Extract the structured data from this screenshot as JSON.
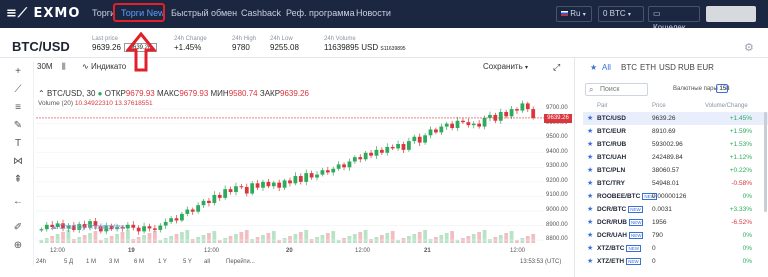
{
  "app": {
    "logo": "EXMO"
  },
  "nav": {
    "items": [
      "Торги",
      "Торги New",
      "Быстрый обмен",
      "Cashback",
      "Реф. программа",
      "Новости"
    ]
  },
  "topbar_right": {
    "language": "Ru",
    "balance": "0 BTC",
    "wallet": "Кошелек"
  },
  "ticker": {
    "pair": "BTC/USD",
    "last_price_label": "Last price",
    "last_price": "9639.26",
    "last_price_badge": "9639.26",
    "change_label": "24h Change",
    "change": "+1.45%",
    "high_label": "24h High",
    "high": "9780",
    "low_label": "24h Low",
    "low": "9255.08",
    "volume_label": "24h Volume",
    "volume": "11639895 USD",
    "volume_btc": "S11639895"
  },
  "chart_toolbar": {
    "interval": "30M",
    "indicators": "Индикато",
    "save": "Сохранить"
  },
  "legend": {
    "symbol": "BTC/USD, 30",
    "open_label": "ОТКР",
    "open": "9679.93",
    "high_label": "МАКС",
    "high": "9679.93",
    "low_label": "МИН",
    "low": "9580.74",
    "close_label": "ЗАКР",
    "close": "9639.26",
    "volume_label": "Volume (20)",
    "volume_a": "10.34922310",
    "volume_b": "13.37618551"
  },
  "chart_data": {
    "type": "candlestick",
    "series": [
      {
        "name": "BTC/USD, 30",
        "values": [
          8875,
          8905,
          8890,
          8915,
          8880,
          8900,
          8870,
          8910,
          8885,
          8930,
          8895,
          8860,
          8900,
          8875,
          8890,
          8880,
          8905,
          8885,
          8860,
          8895,
          8880,
          8870,
          8900,
          8925,
          8950,
          8935,
          8980,
          9010,
          8995,
          9040,
          9070,
          9055,
          9110,
          9090,
          9150,
          9130,
          9170,
          9165,
          9120,
          9190,
          9160,
          9200,
          9170,
          9195,
          9160,
          9210,
          9190,
          9240,
          9200,
          9260,
          9230,
          9250,
          9280,
          9265,
          9290,
          9320,
          9300,
          9340,
          9370,
          9355,
          9400,
          9380,
          9420,
          9400,
          9440,
          9430,
          9460,
          9420,
          9480,
          9510,
          9470,
          9520,
          9560,
          9540,
          9580,
          9600,
          9570,
          9620,
          9610,
          9590,
          9600,
          9580,
          9640,
          9660,
          9620,
          9680,
          9650,
          9700,
          9690,
          9739,
          9700,
          9639
        ]
      }
    ],
    "y_ticks": [
      "9700.00",
      "9600.00",
      "9500.00",
      "9400.00",
      "9300.00",
      "9200.00",
      "9100.00",
      "9000.00",
      "8900.00",
      "8800.00"
    ],
    "ylim": [
      8780,
      9790
    ],
    "x_ticks": [
      "12:00",
      "19",
      "12:00",
      "20",
      "12:00",
      "21",
      "12:00"
    ],
    "current_price": "9639.26"
  },
  "chart_watermark": "Chart by TradingView",
  "ranges": [
    "24h",
    "5 Д",
    "1 M",
    "3 M",
    "6 M",
    "1 Y",
    "5 Y",
    "all",
    "Перейти..."
  ],
  "clock": "13:53:53 (UTC)",
  "market": {
    "tabs": [
      "All",
      "BTC",
      "ETH",
      "USD",
      "RUB",
      "EUR"
    ],
    "search_placeholder": "Поиск",
    "pairs_label": "Валютные пары",
    "pairs_count": "158",
    "col_pair": "Pair",
    "col_price": "Price",
    "col_change": "Volume/Change",
    "rows": [
      {
        "pair": "BTC/USD",
        "price": "9639.26",
        "change": "+1.45%",
        "dir": "up",
        "badge": ""
      },
      {
        "pair": "BTC/EUR",
        "price": "8910.69",
        "change": "+1.59%",
        "dir": "up",
        "badge": ""
      },
      {
        "pair": "BTC/RUB",
        "price": "593002.96",
        "change": "+1.53%",
        "dir": "up",
        "badge": ""
      },
      {
        "pair": "BTC/UAH",
        "price": "242489.84",
        "change": "+1.12%",
        "dir": "up",
        "badge": ""
      },
      {
        "pair": "BTC/PLN",
        "price": "38060.57",
        "change": "+0.22%",
        "dir": "up",
        "badge": ""
      },
      {
        "pair": "BTC/TRY",
        "price": "54948.01",
        "change": "-0.58%",
        "dir": "down",
        "badge": ""
      },
      {
        "pair": "ROOBEE/BTC",
        "price": "0.00000126",
        "change": "0%",
        "dir": "up",
        "badge": "NEW"
      },
      {
        "pair": "DCR/BTC",
        "price": "0.0031",
        "change": "+3.33%",
        "dir": "up",
        "badge": "NEW"
      },
      {
        "pair": "DCR/RUB",
        "price": "1956",
        "change": "-6.52%",
        "dir": "down",
        "badge": "NEW"
      },
      {
        "pair": "DCR/UAH",
        "price": "790",
        "change": "0%",
        "dir": "up",
        "badge": "NEW"
      },
      {
        "pair": "XTZ/BTC",
        "price": "0",
        "change": "0%",
        "dir": "up",
        "badge": "NEW"
      },
      {
        "pair": "XTZ/ETH",
        "price": "0",
        "change": "0%",
        "dir": "up",
        "badge": "NEW"
      }
    ]
  },
  "colors": {
    "up": "#2eaa5c",
    "down": "#d9363e",
    "accent": "#5aa0ff",
    "header": "#1b2741"
  }
}
